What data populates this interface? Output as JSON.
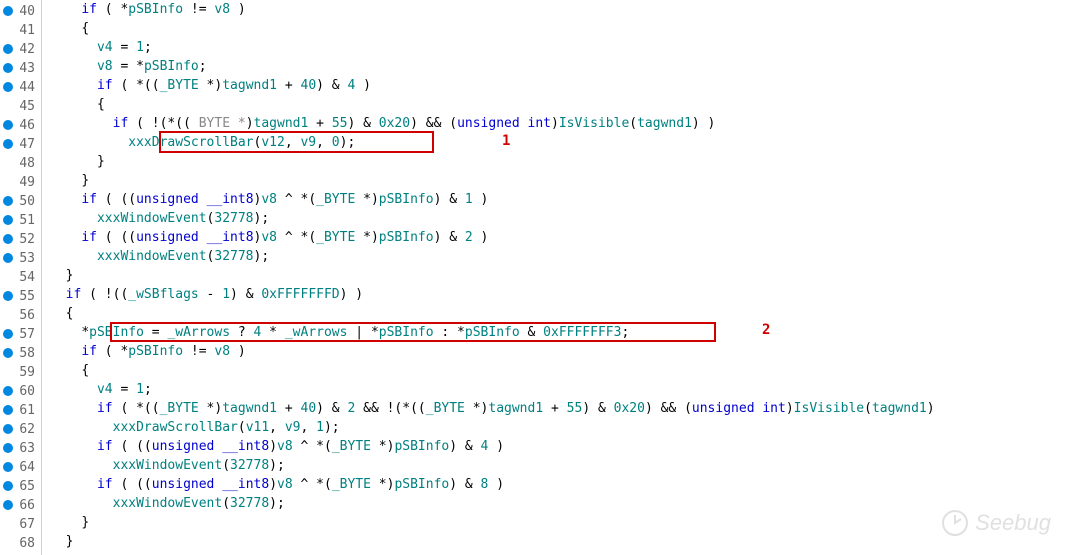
{
  "annotations": {
    "label1": "1",
    "label2": "2"
  },
  "watermark": "Seebug",
  "lines": [
    {
      "n": "40",
      "bp": true,
      "indent": 2,
      "tokens": [
        {
          "t": "kw",
          "v": "if"
        },
        {
          "t": "op",
          "v": " ( "
        },
        {
          "t": "op",
          "v": "*"
        },
        {
          "t": "id-type",
          "v": "pSBInfo"
        },
        {
          "t": "op",
          "v": " != "
        },
        {
          "t": "id-type",
          "v": "v8"
        },
        {
          "t": "op",
          "v": " )"
        }
      ]
    },
    {
      "n": "41",
      "bp": false,
      "indent": 2,
      "tokens": [
        {
          "t": "op",
          "v": "{"
        }
      ]
    },
    {
      "n": "42",
      "bp": true,
      "indent": 3,
      "tokens": [
        {
          "t": "id-type",
          "v": "v4"
        },
        {
          "t": "op",
          "v": " = "
        },
        {
          "t": "num",
          "v": "1"
        },
        {
          "t": "op",
          "v": ";"
        }
      ]
    },
    {
      "n": "43",
      "bp": true,
      "indent": 3,
      "tokens": [
        {
          "t": "id-type",
          "v": "v8"
        },
        {
          "t": "op",
          "v": " = *"
        },
        {
          "t": "id-type",
          "v": "pSBInfo"
        },
        {
          "t": "op",
          "v": ";"
        }
      ]
    },
    {
      "n": "44",
      "bp": true,
      "indent": 3,
      "tokens": [
        {
          "t": "kw",
          "v": "if"
        },
        {
          "t": "op",
          "v": " ( *(("
        },
        {
          "t": "id-type",
          "v": "_BYTE"
        },
        {
          "t": "op",
          "v": " *)"
        },
        {
          "t": "id-type",
          "v": "tagwnd1"
        },
        {
          "t": "op",
          "v": " + "
        },
        {
          "t": "num",
          "v": "40"
        },
        {
          "t": "op",
          "v": ") & "
        },
        {
          "t": "num",
          "v": "4"
        },
        {
          "t": "op",
          "v": " )"
        }
      ]
    },
    {
      "n": "45",
      "bp": false,
      "indent": 3,
      "tokens": [
        {
          "t": "op",
          "v": "{"
        }
      ]
    },
    {
      "n": "46",
      "bp": true,
      "indent": 4,
      "tokens": [
        {
          "t": "kw",
          "v": "if"
        },
        {
          "t": "op",
          "v": " ( !(*(("
        },
        {
          "t": "comment",
          "v": " BYTE *"
        },
        {
          "t": "op",
          "v": ")"
        },
        {
          "t": "id-type",
          "v": "tagwnd1"
        },
        {
          "t": "op",
          "v": " + "
        },
        {
          "t": "num",
          "v": "55"
        },
        {
          "t": "op",
          "v": ") & "
        },
        {
          "t": "num",
          "v": "0x20"
        },
        {
          "t": "op",
          "v": ") && ("
        },
        {
          "t": "kw",
          "v": "unsigned"
        },
        {
          "t": "op",
          "v": " "
        },
        {
          "t": "kw",
          "v": "int"
        },
        {
          "t": "op",
          "v": ")"
        },
        {
          "t": "id-type",
          "v": "IsVisible"
        },
        {
          "t": "op",
          "v": "("
        },
        {
          "t": "id-type",
          "v": "tagwnd1"
        },
        {
          "t": "op",
          "v": ") )"
        }
      ]
    },
    {
      "n": "47",
      "bp": true,
      "indent": 5,
      "tokens": [
        {
          "t": "id-type",
          "v": "xxxDrawScrollBar"
        },
        {
          "t": "op",
          "v": "("
        },
        {
          "t": "id-type",
          "v": "v12"
        },
        {
          "t": "op",
          "v": ", "
        },
        {
          "t": "id-type",
          "v": "v9"
        },
        {
          "t": "op",
          "v": ", "
        },
        {
          "t": "num",
          "v": "0"
        },
        {
          "t": "op",
          "v": ");"
        }
      ]
    },
    {
      "n": "48",
      "bp": false,
      "indent": 3,
      "tokens": [
        {
          "t": "op",
          "v": "}"
        }
      ]
    },
    {
      "n": "49",
      "bp": false,
      "indent": 2,
      "tokens": [
        {
          "t": "op",
          "v": "}"
        }
      ]
    },
    {
      "n": "50",
      "bp": true,
      "indent": 2,
      "tokens": [
        {
          "t": "kw",
          "v": "if"
        },
        {
          "t": "op",
          "v": " ( (("
        },
        {
          "t": "kw",
          "v": "unsigned"
        },
        {
          "t": "op",
          "v": " "
        },
        {
          "t": "kw",
          "v": "__int8"
        },
        {
          "t": "op",
          "v": ")"
        },
        {
          "t": "id-type",
          "v": "v8"
        },
        {
          "t": "op",
          "v": " ^ *("
        },
        {
          "t": "id-type",
          "v": "_BYTE"
        },
        {
          "t": "op",
          "v": " *)"
        },
        {
          "t": "id-type",
          "v": "pSBInfo"
        },
        {
          "t": "op",
          "v": ") & "
        },
        {
          "t": "num",
          "v": "1"
        },
        {
          "t": "op",
          "v": " )"
        }
      ]
    },
    {
      "n": "51",
      "bp": true,
      "indent": 3,
      "tokens": [
        {
          "t": "id-type",
          "v": "xxxWindowEvent"
        },
        {
          "t": "op",
          "v": "("
        },
        {
          "t": "num",
          "v": "32778"
        },
        {
          "t": "op",
          "v": ");"
        }
      ]
    },
    {
      "n": "52",
      "bp": true,
      "indent": 2,
      "tokens": [
        {
          "t": "kw",
          "v": "if"
        },
        {
          "t": "op",
          "v": " ( (("
        },
        {
          "t": "kw",
          "v": "unsigned"
        },
        {
          "t": "op",
          "v": " "
        },
        {
          "t": "kw",
          "v": "__int8"
        },
        {
          "t": "op",
          "v": ")"
        },
        {
          "t": "id-type",
          "v": "v8"
        },
        {
          "t": "op",
          "v": " ^ *("
        },
        {
          "t": "id-type",
          "v": "_BYTE"
        },
        {
          "t": "op",
          "v": " *)"
        },
        {
          "t": "id-type",
          "v": "pSBInfo"
        },
        {
          "t": "op",
          "v": ") & "
        },
        {
          "t": "num",
          "v": "2"
        },
        {
          "t": "op",
          "v": " )"
        }
      ]
    },
    {
      "n": "53",
      "bp": true,
      "indent": 3,
      "tokens": [
        {
          "t": "id-type",
          "v": "xxxWindowEvent"
        },
        {
          "t": "op",
          "v": "("
        },
        {
          "t": "num",
          "v": "32778"
        },
        {
          "t": "op",
          "v": ");"
        }
      ]
    },
    {
      "n": "54",
      "bp": false,
      "indent": 1,
      "tokens": [
        {
          "t": "op",
          "v": "}"
        }
      ]
    },
    {
      "n": "55",
      "bp": true,
      "indent": 1,
      "tokens": [
        {
          "t": "kw",
          "v": "if"
        },
        {
          "t": "op",
          "v": " ( !(("
        },
        {
          "t": "id-type",
          "v": "_wSBflags"
        },
        {
          "t": "op",
          "v": " - "
        },
        {
          "t": "num",
          "v": "1"
        },
        {
          "t": "op",
          "v": ") & "
        },
        {
          "t": "num",
          "v": "0xFFFFFFFD"
        },
        {
          "t": "op",
          "v": ") )"
        }
      ]
    },
    {
      "n": "56",
      "bp": false,
      "indent": 1,
      "tokens": [
        {
          "t": "op",
          "v": "{"
        }
      ]
    },
    {
      "n": "57",
      "bp": true,
      "indent": 2,
      "tokens": [
        {
          "t": "op",
          "v": "*"
        },
        {
          "t": "id-type",
          "v": "pSBInfo"
        },
        {
          "t": "op",
          "v": " = "
        },
        {
          "t": "id-type",
          "v": "_wArrows"
        },
        {
          "t": "op",
          "v": " ? "
        },
        {
          "t": "num",
          "v": "4"
        },
        {
          "t": "op",
          "v": " * "
        },
        {
          "t": "id-type",
          "v": "_wArrows"
        },
        {
          "t": "op",
          "v": " | *"
        },
        {
          "t": "id-type",
          "v": "pSBInfo"
        },
        {
          "t": "op",
          "v": " : *"
        },
        {
          "t": "id-type",
          "v": "pSBInfo"
        },
        {
          "t": "op",
          "v": " & "
        },
        {
          "t": "num",
          "v": "0xFFFFFFF3"
        },
        {
          "t": "op",
          "v": ";"
        }
      ]
    },
    {
      "n": "58",
      "bp": true,
      "indent": 2,
      "tokens": [
        {
          "t": "kw",
          "v": "if"
        },
        {
          "t": "op",
          "v": " ( *"
        },
        {
          "t": "id-type",
          "v": "pSBInfo"
        },
        {
          "t": "op",
          "v": " != "
        },
        {
          "t": "id-type",
          "v": "v8"
        },
        {
          "t": "op",
          "v": " )"
        }
      ]
    },
    {
      "n": "59",
      "bp": false,
      "indent": 2,
      "tokens": [
        {
          "t": "op",
          "v": "{"
        }
      ]
    },
    {
      "n": "60",
      "bp": true,
      "indent": 3,
      "tokens": [
        {
          "t": "id-type",
          "v": "v4"
        },
        {
          "t": "op",
          "v": " = "
        },
        {
          "t": "num",
          "v": "1"
        },
        {
          "t": "op",
          "v": ";"
        }
      ]
    },
    {
      "n": "61",
      "bp": true,
      "indent": 3,
      "tokens": [
        {
          "t": "kw",
          "v": "if"
        },
        {
          "t": "op",
          "v": " ( *(("
        },
        {
          "t": "id-type",
          "v": "_BYTE"
        },
        {
          "t": "op",
          "v": " *)"
        },
        {
          "t": "id-type",
          "v": "tagwnd1"
        },
        {
          "t": "op",
          "v": " + "
        },
        {
          "t": "num",
          "v": "40"
        },
        {
          "t": "op",
          "v": ") & "
        },
        {
          "t": "num",
          "v": "2"
        },
        {
          "t": "op",
          "v": " && !(*(("
        },
        {
          "t": "id-type",
          "v": "_BYTE"
        },
        {
          "t": "op",
          "v": " *)"
        },
        {
          "t": "id-type",
          "v": "tagwnd1"
        },
        {
          "t": "op",
          "v": " + "
        },
        {
          "t": "num",
          "v": "55"
        },
        {
          "t": "op",
          "v": ") & "
        },
        {
          "t": "num",
          "v": "0x20"
        },
        {
          "t": "op",
          "v": ") && ("
        },
        {
          "t": "kw",
          "v": "unsigned"
        },
        {
          "t": "op",
          "v": " "
        },
        {
          "t": "kw",
          "v": "int"
        },
        {
          "t": "op",
          "v": ")"
        },
        {
          "t": "id-type",
          "v": "IsVisible"
        },
        {
          "t": "op",
          "v": "("
        },
        {
          "t": "id-type",
          "v": "tagwnd1"
        },
        {
          "t": "op",
          "v": ")"
        }
      ]
    },
    {
      "n": "62",
      "bp": true,
      "indent": 4,
      "tokens": [
        {
          "t": "id-type",
          "v": "xxxDrawScrollBar"
        },
        {
          "t": "op",
          "v": "("
        },
        {
          "t": "id-type",
          "v": "v11"
        },
        {
          "t": "op",
          "v": ", "
        },
        {
          "t": "id-type",
          "v": "v9"
        },
        {
          "t": "op",
          "v": ", "
        },
        {
          "t": "num",
          "v": "1"
        },
        {
          "t": "op",
          "v": ");"
        }
      ]
    },
    {
      "n": "63",
      "bp": true,
      "indent": 3,
      "tokens": [
        {
          "t": "kw",
          "v": "if"
        },
        {
          "t": "op",
          "v": " ( (("
        },
        {
          "t": "kw",
          "v": "unsigned"
        },
        {
          "t": "op",
          "v": " "
        },
        {
          "t": "kw",
          "v": "__int8"
        },
        {
          "t": "op",
          "v": ")"
        },
        {
          "t": "id-type",
          "v": "v8"
        },
        {
          "t": "op",
          "v": " ^ *("
        },
        {
          "t": "id-type",
          "v": "_BYTE"
        },
        {
          "t": "op",
          "v": " *)"
        },
        {
          "t": "id-type",
          "v": "pSBInfo"
        },
        {
          "t": "op",
          "v": ") & "
        },
        {
          "t": "num",
          "v": "4"
        },
        {
          "t": "op",
          "v": " )"
        }
      ]
    },
    {
      "n": "64",
      "bp": true,
      "indent": 4,
      "tokens": [
        {
          "t": "id-type",
          "v": "xxxWindowEvent"
        },
        {
          "t": "op",
          "v": "("
        },
        {
          "t": "num",
          "v": "32778"
        },
        {
          "t": "op",
          "v": ");"
        }
      ]
    },
    {
      "n": "65",
      "bp": true,
      "indent": 3,
      "tokens": [
        {
          "t": "kw",
          "v": "if"
        },
        {
          "t": "op",
          "v": " ( (("
        },
        {
          "t": "kw",
          "v": "unsigned"
        },
        {
          "t": "op",
          "v": " "
        },
        {
          "t": "kw",
          "v": "__int8"
        },
        {
          "t": "op",
          "v": ")"
        },
        {
          "t": "id-type",
          "v": "v8"
        },
        {
          "t": "op",
          "v": " ^ *("
        },
        {
          "t": "id-type",
          "v": "_BYTE"
        },
        {
          "t": "op",
          "v": " *)"
        },
        {
          "t": "id-type",
          "v": "pSBInfo"
        },
        {
          "t": "op",
          "v": ") & "
        },
        {
          "t": "num",
          "v": "8"
        },
        {
          "t": "op",
          "v": " )"
        }
      ]
    },
    {
      "n": "66",
      "bp": true,
      "indent": 4,
      "tokens": [
        {
          "t": "id-type",
          "v": "xxxWindowEvent"
        },
        {
          "t": "op",
          "v": "("
        },
        {
          "t": "num",
          "v": "32778"
        },
        {
          "t": "op",
          "v": ");"
        }
      ]
    },
    {
      "n": "67",
      "bp": false,
      "indent": 2,
      "tokens": [
        {
          "t": "op",
          "v": "}"
        }
      ]
    },
    {
      "n": "68",
      "bp": false,
      "indent": 1,
      "tokens": [
        {
          "t": "op",
          "v": "}"
        }
      ]
    }
  ]
}
